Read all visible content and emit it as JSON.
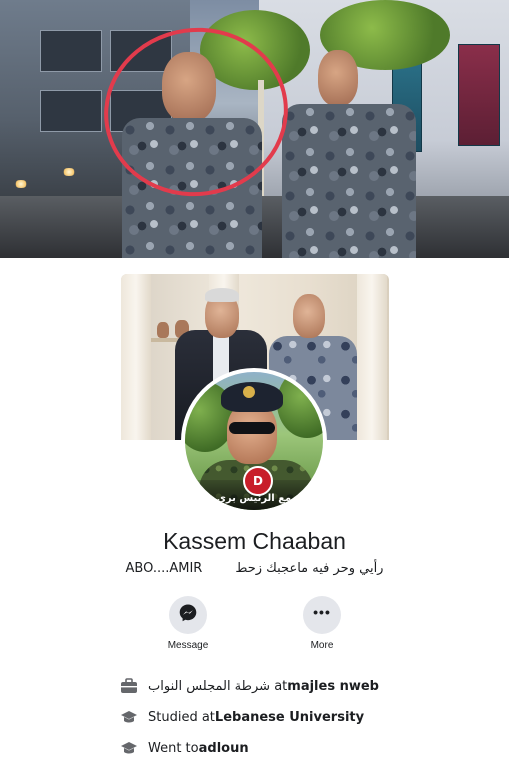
{
  "top_photo": {
    "description_icon": "street-photo",
    "highlight_color": "#e23b4c"
  },
  "cover_photo": {
    "icon": "cover-photo"
  },
  "avatar": {
    "logo_text": "D",
    "caption": "مع الرئيس بري"
  },
  "profile": {
    "name": "Kassem Chaaban",
    "bio": "ABO....AMIR        رأيي وحر فيه ماعجبك زحط"
  },
  "actions": {
    "message_label": "Message",
    "more_label": "More",
    "message_icon": "messenger-icon",
    "more_icon": "more-dots-icon",
    "more_dots": "•••"
  },
  "info": {
    "work_prefix": "شرطة المجلس النواب at ",
    "work_place": "majles nweb",
    "study_prefix": "Studied at ",
    "study_place": "Lebanese University",
    "went_prefix": "Went to ",
    "went_place": "adloun"
  },
  "colors": {
    "button_bg": "#e4e6eb",
    "text": "#1c1e21",
    "icon_gray": "#65676b"
  }
}
